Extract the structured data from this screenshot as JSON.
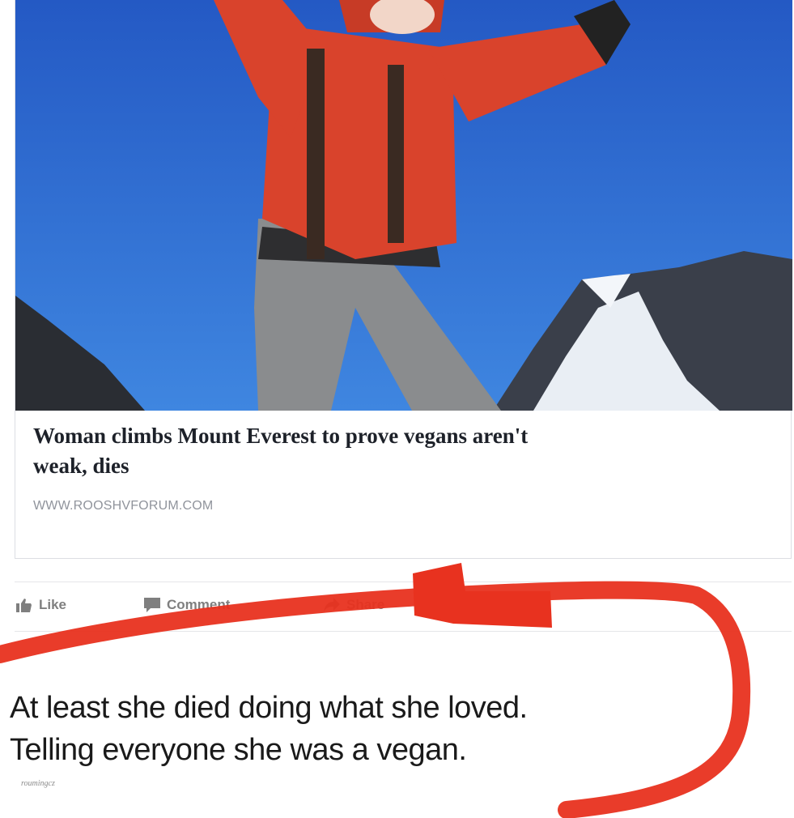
{
  "link_preview": {
    "headline_line1": "Woman climbs Mount Everest to prove vegans aren't",
    "headline_line2": "weak, dies",
    "source": "WWW.ROOSHVFORUM.COM"
  },
  "actions": {
    "like": "Like",
    "comment": "Comment",
    "share": "Share"
  },
  "caption": {
    "line1": "At least she died doing what she loved.",
    "line2": "Telling everyone she was a vegan."
  },
  "watermark": "roumingcz",
  "colors": {
    "sky": "#2f6fd0",
    "jacket": "#d9432c",
    "marker": "#e8321f",
    "action_gray": "#7f7f7f"
  }
}
